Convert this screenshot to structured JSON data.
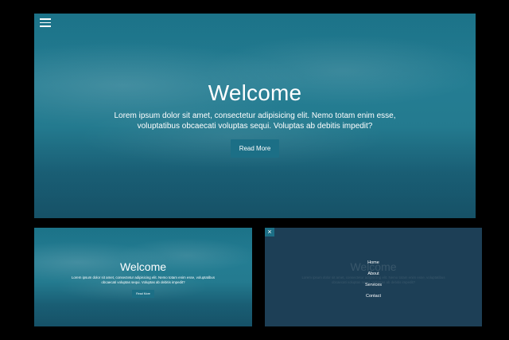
{
  "hero": {
    "title": "Welcome",
    "text": "Lorem ipsum dolor sit amet, consectetur adipisicing elit. Nemo totam enim esse, voluptatibus obcaecati voluptas sequi. Voluptas ab debitis impedit?",
    "button_label": "Read More"
  },
  "preview_small": {
    "title": "Welcome",
    "text": "Lorem ipsum dolor sit amet, consectetur adipisicing elit. Nemo totam enim esse, voluptatibus obcaecati voluptas sequi. Voluptas ab debitis impedit?",
    "button_label": "Read More"
  },
  "menu_preview": {
    "close_label": "×",
    "ghost_title": "Welcome",
    "ghost_text": "Lorem ipsum dolor sit amet, consectetur adipisicing elit. Nemo totam enim esse, voluptatibus obcaecati voluptas sequi. Voluptas ab debitis impedit?",
    "nav_items": [
      "Home",
      "About",
      "Services",
      "Contact"
    ]
  },
  "icons": {
    "menu": "hamburger-icon",
    "close": "close-icon"
  },
  "colors": {
    "accent": "#1c6f86",
    "menu_background": "#1d3f56",
    "ocean": "#2a8ea4"
  }
}
